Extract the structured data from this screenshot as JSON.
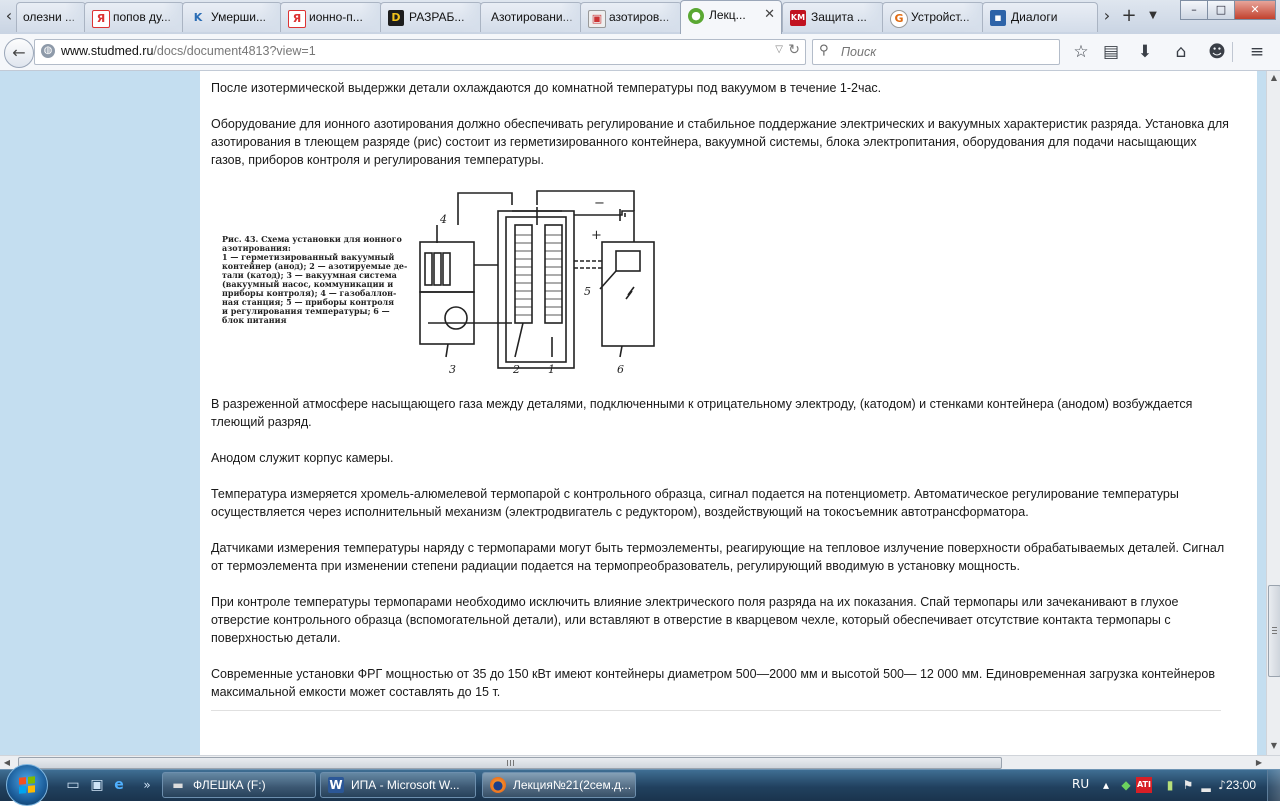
{
  "tabs": [
    {
      "label": "олезни ...",
      "favicon": "generic-page-icon"
    },
    {
      "label": "попов ду...",
      "favicon": "yandex-icon"
    },
    {
      "label": "Умерши...",
      "favicon": "k-icon"
    },
    {
      "label": "ионно-п...",
      "favicon": "yandex-icon"
    },
    {
      "label": "РАЗРАБ...",
      "favicon": "d-icon"
    },
    {
      "label": "Азотировани...",
      "favicon": "generic-page-icon"
    },
    {
      "label": "азотиров...",
      "favicon": "image-icon"
    },
    {
      "label": "Лекц...",
      "favicon": "studmed-icon",
      "active": true
    },
    {
      "label": "Защита ...",
      "favicon": "km-icon"
    },
    {
      "label": "Устройст...",
      "favicon": "google-icon"
    },
    {
      "label": "Диалоги",
      "favicon": "dialog-icon"
    }
  ],
  "navbar": {
    "url_domain": "www.studmed.ru",
    "url_path": "/docs/document4813?view=1",
    "search_placeholder": "Поиск"
  },
  "article": {
    "paragraphs": [
      "После изотермической выдержки детали охлаждаются до комнатной температуры под вакуумом в течение 1-2час.",
      "Оборудование для ионного азотирования должно обеспечивать регулирование и стабильное поддержание электрических и вакуумных характеристик разряда. Установка для азотирования в тлеющем разряде (рис) состоит из герметизированного контейнера, вакуумной системы, блока электропитания, оборудования для подачи насыщающих газов, приборов контроля и регулирования температуры.",
      "В разреженной атмосфере насыщающего газа между деталями, подключенными к отрицательному электроду, (катодом) и стенками контейнера (анодом) возбуждается тлеющий разряд.",
      "Анодом служит корпус камеры.",
      "Температура измеряется хромель-алюмелевой термопарой с контрольного образца, сигнал подается на потенциометр. Автоматическое регулирование температуры осуществляется через исполнительный механизм (электродвигатель с редуктором), воздействующий на токосъемник автотрансформатора.",
      "Датчиками измерения температуры наряду с термопарами могут быть термоэлементы, реагирующие на тепловое излучение поверхности обрабатываемых деталей. Сигнал от термоэлемента при изменении степени радиации подается на термопреобразователь, регулирующий вводимую в установку мощность.",
      "При контроле температуры термопарами необходимо исключить влияние электрического поля разряда на их показания. Спай термопары или зачеканивают в глухое отверстие контрольного образца (вспомогательной детали), или вставляют в отверстие в кварцевом чехле, который обеспечивает отсутствие контакта термопары с поверхностью детали.",
      "Современные установки ФРГ мощностью от 35 до 150 кВт имеют контейнеры диаметром 500—2000 мм и высотой 500— 12 000 мм. Единовременная загрузка контейнеров максимальной емкости может составлять до 15 т."
    ],
    "figure": {
      "caption_lines": [
        "Рис. 43. Схема установки для ионного",
        "азотирования:",
        "1 — герметизированный вакуумный",
        "контейнер (анод); 2 — азотируемые де-",
        "тали (катод); 3 — вакуумная система",
        "(вакуумный насос, коммуникации и",
        "приборы контроля); 4 — газобаллон-",
        "ная станция; 5 — приборы контроля",
        "и регулирования температуры; 6 —",
        "блок питания"
      ],
      "labels": [
        "1",
        "2",
        "3",
        "4",
        "5",
        "6",
        "+",
        "−"
      ]
    }
  },
  "taskbar": {
    "tasks": [
      {
        "label": "ФЛЕШКА (F:)",
        "icon": "drive-icon"
      },
      {
        "label": "ИПА - Microsoft W...",
        "icon": "word-icon"
      },
      {
        "label": "Лекция№21(2сем.д...",
        "icon": "firefox-icon",
        "active": true
      }
    ],
    "language": "RU",
    "clock": "23:00"
  },
  "colors": {
    "page_background": "#c4def0",
    "taskbar": "#21415f",
    "active_tab": "#f5f7fa"
  }
}
